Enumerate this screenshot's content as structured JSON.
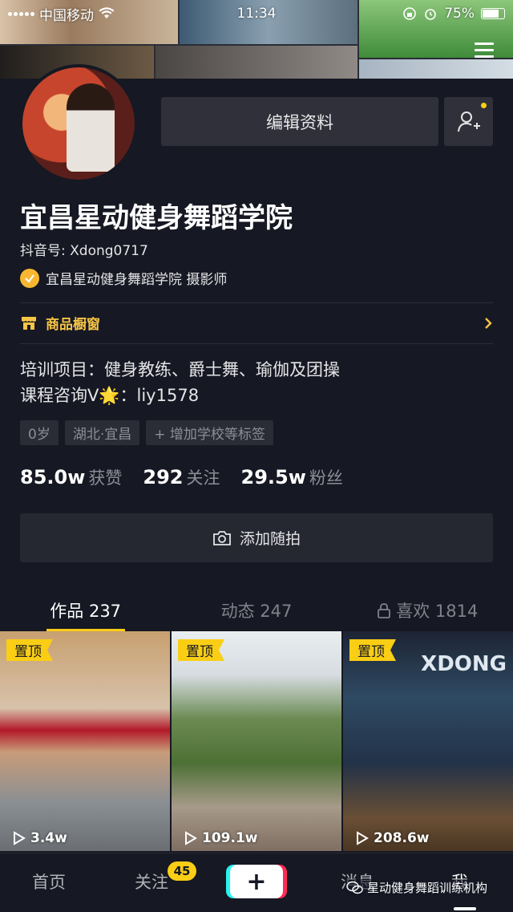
{
  "status_bar": {
    "carrier": "中国移动",
    "time": "11:34",
    "battery": "75%"
  },
  "profile": {
    "edit_label": "编辑资料",
    "name": "宜昌星动健身舞蹈学院",
    "douyin_id": "抖音号: Xdong0717",
    "verification": "宜昌星动健身舞蹈学院  摄影师",
    "shop_label": "商品橱窗",
    "bio_line1": "培训项目：健身教练、爵士舞、瑜伽及团操",
    "bio_line2": "课程咨询V🌟：liy1578",
    "tags": [
      "0岁",
      "湖北·宜昌",
      "+ 增加学校等标签"
    ],
    "stats": [
      {
        "num": "85.0w",
        "label": "获赞"
      },
      {
        "num": "292",
        "label": "关注"
      },
      {
        "num": "29.5w",
        "label": "粉丝"
      }
    ],
    "snap_label": "添加随拍"
  },
  "tabs": [
    {
      "label": "作品 237"
    },
    {
      "label": "动态 247"
    },
    {
      "label": "喜欢 1814"
    }
  ],
  "videos": [
    {
      "pin": "置顶",
      "plays": "3.4w"
    },
    {
      "pin": "置顶",
      "plays": "109.1w"
    },
    {
      "pin": "置顶",
      "plays": "208.6w",
      "brand": "XDONG"
    }
  ],
  "navbar": {
    "home": "首页",
    "follow": "关注",
    "follow_badge": "45",
    "plus": "+",
    "messages": "消息",
    "me": "我"
  },
  "watermark": "星动健身舞蹈训练机构",
  "colors": {
    "background": "#161823",
    "accent": "#face15",
    "card": "#2f3039"
  }
}
